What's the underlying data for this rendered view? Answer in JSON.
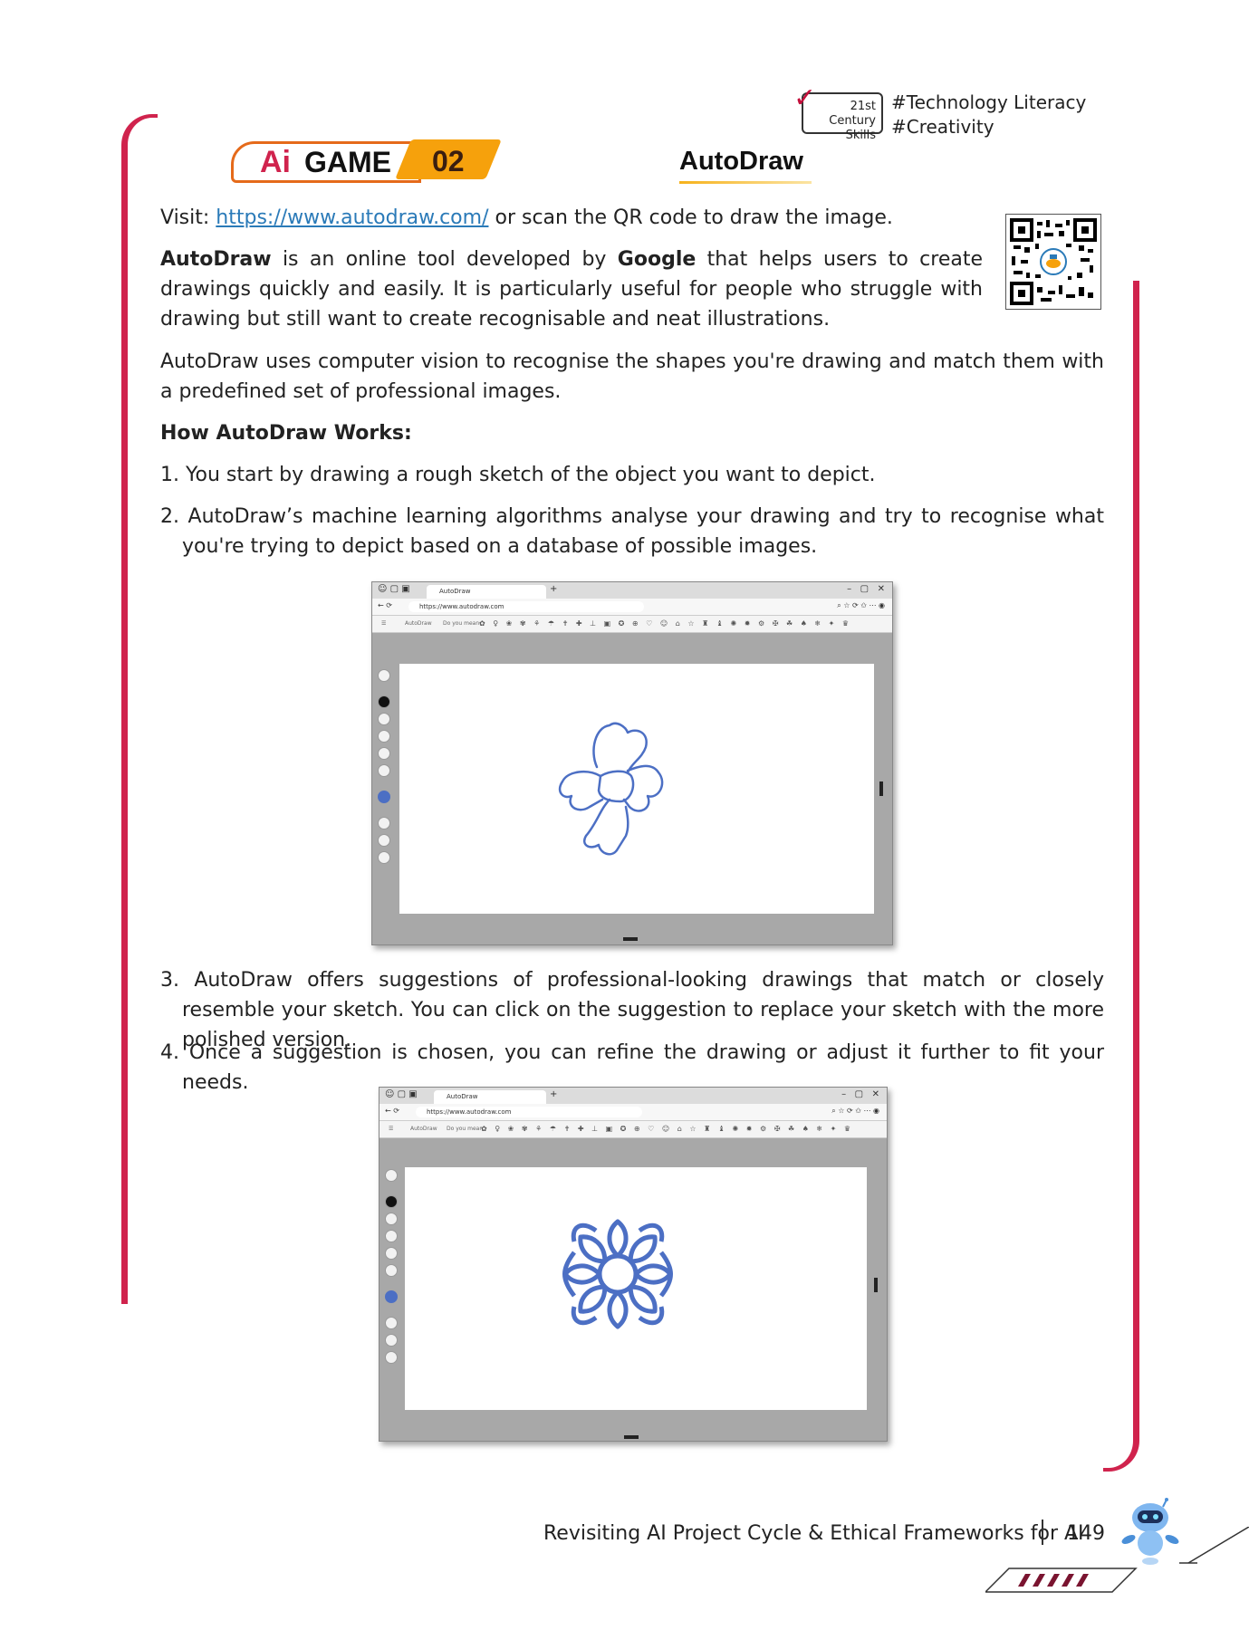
{
  "skills_badge": {
    "line1": "21st Century",
    "line2": "Skills",
    "check": "✓"
  },
  "tags": [
    "#Technology Literacy",
    "#Creativity"
  ],
  "game_badge": {
    "ai": "Ai",
    "word": "GAME",
    "number": "02"
  },
  "title": "AutoDraw",
  "visit": {
    "prefix": "Visit: ",
    "url": "https://www.autodraw.com/",
    "suffix": " or scan the QR code to draw the image."
  },
  "intro": {
    "bold1": "AutoDraw",
    "text1": " is an online tool developed by ",
    "bold2": "Google",
    "text2": " that helps users to create drawings quickly and easily. It is particularly useful for people who struggle with drawing but still want to create recognisable and neat illustrations."
  },
  "para2": "AutoDraw uses computer vision to recognise the shapes you're drawing and match them with a predefined set of professional images.",
  "how_heading": "How AutoDraw Works:",
  "steps": [
    {
      "num": "1.",
      "text": "You start by drawing a rough sketch of the object you want to depict."
    },
    {
      "num": "2.",
      "text": "AutoDraw’s machine learning algorithms analyse your drawing and try to recognise what you're trying to depict based on a database of possible images."
    },
    {
      "num": "3.",
      "text": "AutoDraw offers suggestions of professional-looking drawings that match or closely resemble your sketch. You can click on the suggestion to replace your sketch with the more polished version."
    },
    {
      "num": "4.",
      "text": "Once a suggestion is chosen, you can refine the drawing or adjust it further to fit your needs."
    }
  ],
  "browser": {
    "tab_title": "AutoDraw",
    "url": "https://www.autodraw.com",
    "toolbar_brand": "AutoDraw",
    "toolbar_hint": "Do you mean:"
  },
  "footer": {
    "chapter": "Revisiting AI Project Cycle & Ethical Frameworks for AI",
    "page": "149"
  },
  "colors": {
    "accent_red": "#d0234d",
    "accent_orange": "#f6a10c",
    "link": "#2a7ab8",
    "drawing_blue": "#4c6fc4"
  }
}
